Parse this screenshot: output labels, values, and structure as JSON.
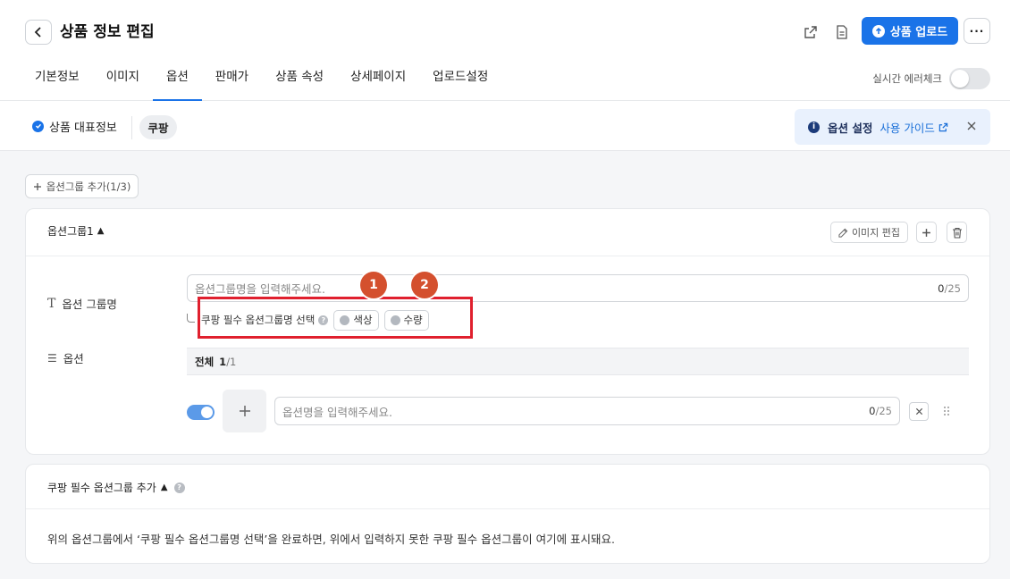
{
  "header": {
    "title": "상품 정보 편집",
    "upload_label": "상품 업로드",
    "more_label": "···"
  },
  "tabs": [
    {
      "label": "기본정보"
    },
    {
      "label": "이미지"
    },
    {
      "label": "옵션",
      "active": true
    },
    {
      "label": "판매가"
    },
    {
      "label": "상품 속성"
    },
    {
      "label": "상세페이지"
    },
    {
      "label": "업로드설정"
    }
  ],
  "realtime_check": {
    "label": "실시간 에러체크",
    "enabled": false
  },
  "subbar": {
    "rep_info_label": "상품 대표정보",
    "market_chip": "쿠팡"
  },
  "guide": {
    "title": "옵션 설정",
    "link": "사용 가이드"
  },
  "add_group_label": "옵션그룹 추가(1/3)",
  "option_group": {
    "title": "옵션그룹1",
    "edit_image_label": "이미지 편집",
    "group_name_label": "옵션 그룹명",
    "group_name_placeholder": "옵션그룹명을 입력해주세요.",
    "group_name_count": "0",
    "group_name_max": "/25",
    "required_select_label": "쿠팡 필수 옵션그룹명 선택",
    "required_chips": [
      "색상",
      "수량"
    ],
    "options_label": "옵션",
    "list_header_label": "전체",
    "list_header_count": "1",
    "list_header_total": "/1",
    "option_enabled": true,
    "option_placeholder": "옵션명을 입력해주세요.",
    "option_count": "0",
    "option_max": "/25"
  },
  "annotations": {
    "badge1": "1",
    "badge2": "2"
  },
  "required_groups": {
    "title": "쿠팡 필수 옵션그룹 추가",
    "description": "위의 옵션그룹에서 ‘쿠팡 필수 옵션그룹명 선택’을 완료하면, 위에서 입력하지 못한 쿠팡 필수 옵션그룹이 여기에 표시돼요."
  },
  "colors": {
    "primary": "#1a73e8",
    "highlight": "#e0202e",
    "badge": "#d4502e"
  }
}
